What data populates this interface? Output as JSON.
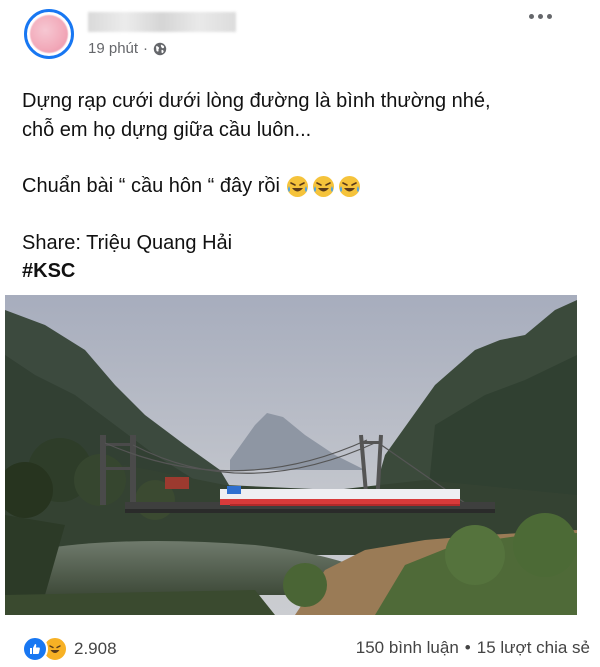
{
  "header": {
    "time": "19 phút",
    "separator": "·",
    "privacy_icon": "globe-icon",
    "menu_icon": "more-horizontal-icon"
  },
  "post": {
    "line1": "Dựng rạp cưới dưới lòng đường là bình thường nhé,",
    "line2": "chỗ em họ dựng giữa cầu luôn...",
    "line3": "Chuẩn bài “ cầu hôn “ đây rồi",
    "line3_emoji": "tears-of-joy-emoji",
    "line4": "Share: Triệu Quang Hải",
    "hashtag": "#KSC"
  },
  "footer": {
    "reaction_icons": [
      "like-icon",
      "haha-icon"
    ],
    "reaction_count": "2.908",
    "comments": "150 bình luận",
    "dot": "•",
    "shares": "15 lượt chia sẻ"
  },
  "colors": {
    "accent": "#1877f2",
    "haha": "#f7b125",
    "meta_text": "#65676b"
  }
}
